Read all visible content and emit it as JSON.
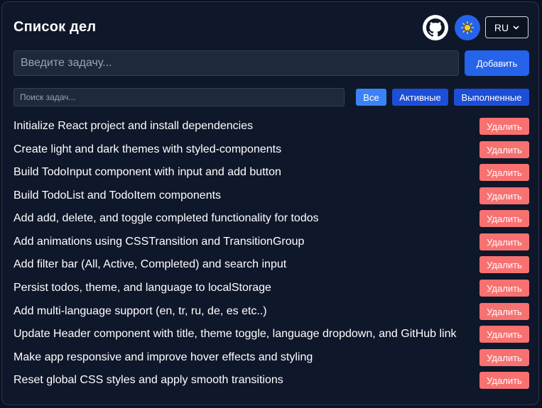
{
  "header": {
    "title": "Список дел",
    "github_icon": "github-icon",
    "theme_icon": "sun-icon",
    "language": "RU"
  },
  "input": {
    "placeholder": "Введите задачу...",
    "add_label": "Добавить"
  },
  "search": {
    "placeholder": "Поиск задач..."
  },
  "filters": [
    {
      "label": "Все"
    },
    {
      "label": "Активные"
    },
    {
      "label": "Выполненные"
    }
  ],
  "todos": [
    {
      "text": "Initialize React project and install dependencies",
      "delete_label": "Удалить"
    },
    {
      "text": "Create light and dark themes with styled-components",
      "delete_label": "Удалить"
    },
    {
      "text": "Build TodoInput component with input and add button",
      "delete_label": "Удалить"
    },
    {
      "text": "Build TodoList and TodoItem components",
      "delete_label": "Удалить"
    },
    {
      "text": "Add add, delete, and toggle completed functionality for todos",
      "delete_label": "Удалить"
    },
    {
      "text": "Add animations using CSSTransition and TransitionGroup",
      "delete_label": "Удалить"
    },
    {
      "text": "Add filter bar (All, Active, Completed) and search input",
      "delete_label": "Удалить"
    },
    {
      "text": "Persist todos, theme, and language to localStorage",
      "delete_label": "Удалить"
    },
    {
      "text": "Add multi-language support (en, tr, ru, de, es etc..)",
      "delete_label": "Удалить"
    },
    {
      "text": "Update Header component with title, theme toggle, language dropdown, and GitHub link",
      "delete_label": "Удалить"
    },
    {
      "text": "Make app responsive and improve hover effects and styling",
      "delete_label": "Удалить"
    },
    {
      "text": "Reset global CSS styles and apply smooth transitions",
      "delete_label": "Удалить"
    }
  ],
  "colors": {
    "background": "#0f172a",
    "primary": "#2563eb",
    "active_filter": "#3b82f6",
    "filter": "#1d4ed8",
    "delete": "#f87171"
  }
}
